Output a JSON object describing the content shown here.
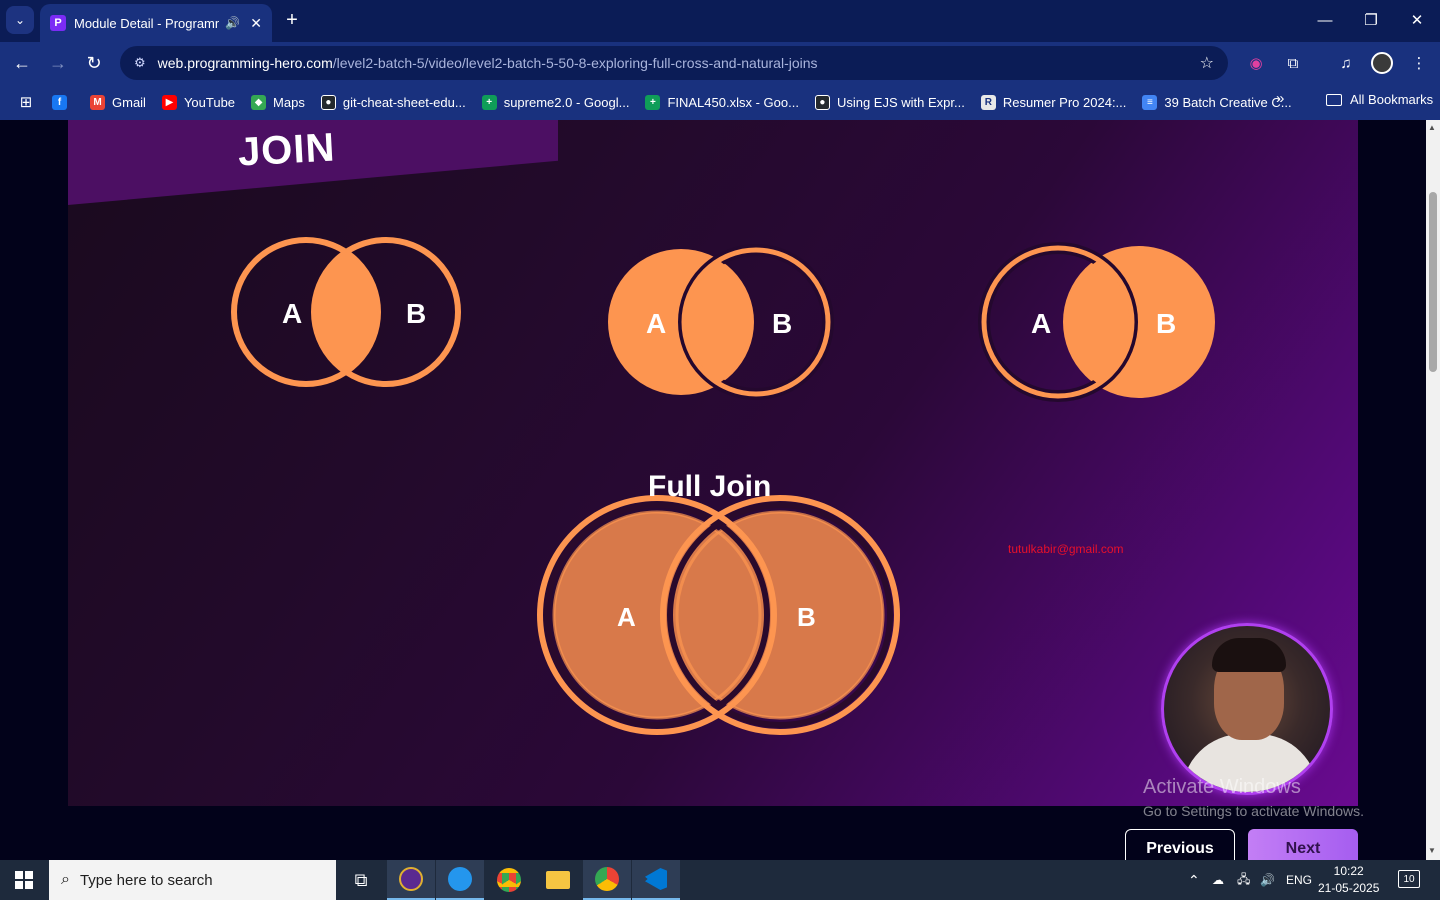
{
  "browser": {
    "tab": {
      "title": "Module Detail - Programmi",
      "favicon": "P"
    },
    "address": {
      "host": "web.programming-hero.com",
      "path": "/level2-batch-5/video/level2-batch-5-50-8-exploring-full-cross-and-natural-joins"
    },
    "bookmarks": [
      {
        "label": "",
        "icon": "facebook-icon",
        "color": "#1877f2",
        "glyph": "f"
      },
      {
        "label": "Gmail",
        "icon": "gmail-icon",
        "color": "#ea4335",
        "glyph": "M"
      },
      {
        "label": "YouTube",
        "icon": "youtube-icon",
        "color": "#ff0000",
        "glyph": "▶"
      },
      {
        "label": "Maps",
        "icon": "maps-icon",
        "color": "#34a853",
        "glyph": "◆"
      },
      {
        "label": "git-cheat-sheet-edu...",
        "icon": "github-icon",
        "color": "#24292e",
        "glyph": "●"
      },
      {
        "label": "supreme2.0 - Googl...",
        "icon": "sheets-icon",
        "color": "#0f9d58",
        "glyph": "+"
      },
      {
        "label": "FINAL450.xlsx - Goo...",
        "icon": "sheets-icon",
        "color": "#0f9d58",
        "glyph": "+"
      },
      {
        "label": "Using EJS with Expr...",
        "icon": "github-icon",
        "color": "#24292e",
        "glyph": "●"
      },
      {
        "label": "Resumer Pro 2024:...",
        "icon": "resumer-icon",
        "color": "#e8e8e8",
        "glyph": "R"
      },
      {
        "label": "39 Batch Creative C...",
        "icon": "docs-icon",
        "color": "#4285f4",
        "glyph": "≡"
      }
    ],
    "all_bookmarks": "All Bookmarks"
  },
  "slide": {
    "title": "JOIN",
    "full_join_title": "Full Join",
    "label_a": "A",
    "label_b": "B",
    "email": "tutulkabir@gmail.com",
    "colors": {
      "orange": "#fd9550",
      "full_join": "#d8794a",
      "banner": "#4c0f63"
    }
  },
  "watermark": {
    "line1": "Activate Windows",
    "line2": "Go to Settings to activate Windows."
  },
  "nav": {
    "previous": "Previous",
    "next": "Next"
  },
  "taskbar": {
    "search_placeholder": "Type here to search",
    "language": "ENG",
    "time": "10:22",
    "date": "21-05-2025",
    "notifications": "10"
  }
}
